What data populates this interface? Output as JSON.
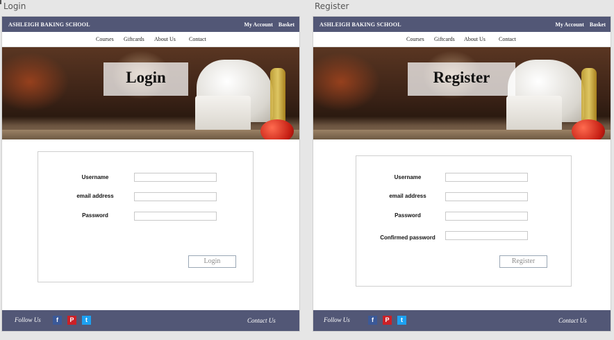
{
  "artboards": {
    "login_label": "Login",
    "register_label": "Register"
  },
  "header": {
    "brand": "ASHLEIGH BAKING SCHOOL",
    "my_account": "My Account",
    "basket": "Basket"
  },
  "nav": {
    "courses": "Courses",
    "giftcards": "Giftcards",
    "about": "About Us",
    "contact": "Contact"
  },
  "login": {
    "title": "Login",
    "username_label": "Username",
    "email_label": "email address",
    "password_label": "Password",
    "button": "Login"
  },
  "register": {
    "title": "Register",
    "username_label": "Username",
    "email_label": "email address",
    "password_label": "Password",
    "confirm_label": "Confirmed password",
    "button": "Register"
  },
  "footer": {
    "follow": "Follow Us",
    "contact": "Contact Us",
    "social": [
      {
        "icon": "facebook-icon",
        "glyph": "f",
        "color": "#3b5998"
      },
      {
        "icon": "pinterest-icon",
        "glyph": "P",
        "color": "#cb2027"
      },
      {
        "icon": "twitter-icon",
        "glyph": "t",
        "color": "#1da1f2"
      }
    ]
  },
  "colors": {
    "header_bg": "#525776",
    "button_border": "#9aa7b5"
  }
}
